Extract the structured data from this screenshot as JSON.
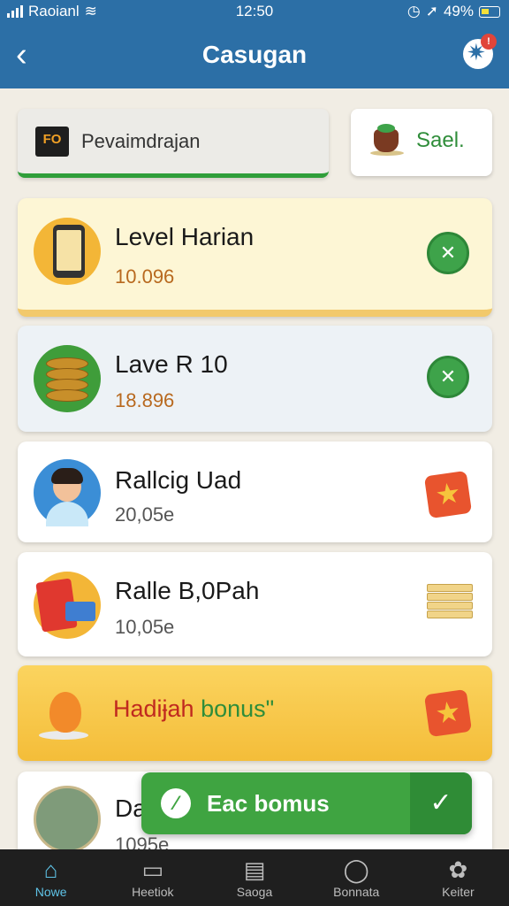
{
  "status_bar": {
    "carrier": "Raoianl",
    "time": "12:50",
    "battery": "49%"
  },
  "app_bar": {
    "title": "Casugan",
    "badge": "!"
  },
  "search": {
    "logo_text": "FO",
    "text": "Pevaimdrajan"
  },
  "sale_button": {
    "label": "Sael."
  },
  "cards": [
    {
      "name": "Level Harian",
      "value": "10.096",
      "value_color": "#b8691f",
      "action": "green"
    },
    {
      "name": "Lave R 10",
      "value": "18.896",
      "value_color": "#b8691f",
      "action": "green"
    },
    {
      "name": "Rallcig Uad",
      "value": "20,05e",
      "value_color": "#555555",
      "action": "star"
    },
    {
      "name": "Ralle B,0Pah",
      "value": "10,05e",
      "value_color": "#555555",
      "action": "stack"
    },
    {
      "name_part1": "Hadiɉah",
      "name_part2": "bonus\"",
      "action": "star"
    },
    {
      "name": "Da",
      "value": "1095e"
    }
  ],
  "toast": {
    "text": "Eac bomus"
  },
  "bottom_nav": [
    {
      "label": "Nowe",
      "icon": "home-icon",
      "active": true
    },
    {
      "label": "Heetiok",
      "icon": "folder-icon",
      "active": false
    },
    {
      "label": "Saoga",
      "icon": "document-icon",
      "active": false
    },
    {
      "label": "Bonnata",
      "icon": "user-icon",
      "active": false
    },
    {
      "label": "Keiter",
      "icon": "badge-icon",
      "active": false
    }
  ],
  "colors": {
    "primary": "#2c6fa6",
    "accent_green": "#3ea34a",
    "bonus_yellow": "#f4bd39",
    "nav_active": "#5fc4e8"
  }
}
